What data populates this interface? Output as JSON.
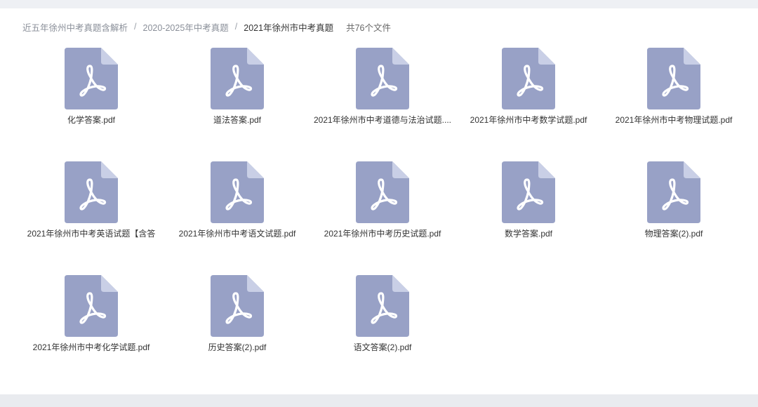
{
  "breadcrumb": {
    "items": [
      "近五年徐州中考真题含解析",
      "2020-2025年中考真题",
      "2021年徐州市中考真题"
    ],
    "separator": "/",
    "count_text": "共76个文件"
  },
  "file_icon": {
    "name": "pdf-file-icon",
    "body_color": "#98a1c6",
    "fold_color": "#c9cfe6",
    "glyph_color": "#ffffff"
  },
  "files": [
    {
      "name": "化学答案.pdf"
    },
    {
      "name": "道法答案.pdf"
    },
    {
      "name": "2021年徐州市中考道德与法治试题...."
    },
    {
      "name": "2021年徐州市中考数学试题.pdf"
    },
    {
      "name": "2021年徐州市中考物理试题.pdf"
    },
    {
      "name": "2021年徐州市中考英语试题【含答"
    },
    {
      "name": "2021年徐州市中考语文试题.pdf"
    },
    {
      "name": "2021年徐州市中考历史试题.pdf"
    },
    {
      "name": "数学答案.pdf"
    },
    {
      "name": "物理答案(2).pdf"
    },
    {
      "name": "2021年徐州市中考化学试题.pdf"
    },
    {
      "name": "历史答案(2).pdf"
    },
    {
      "name": "语文答案(2).pdf"
    }
  ]
}
